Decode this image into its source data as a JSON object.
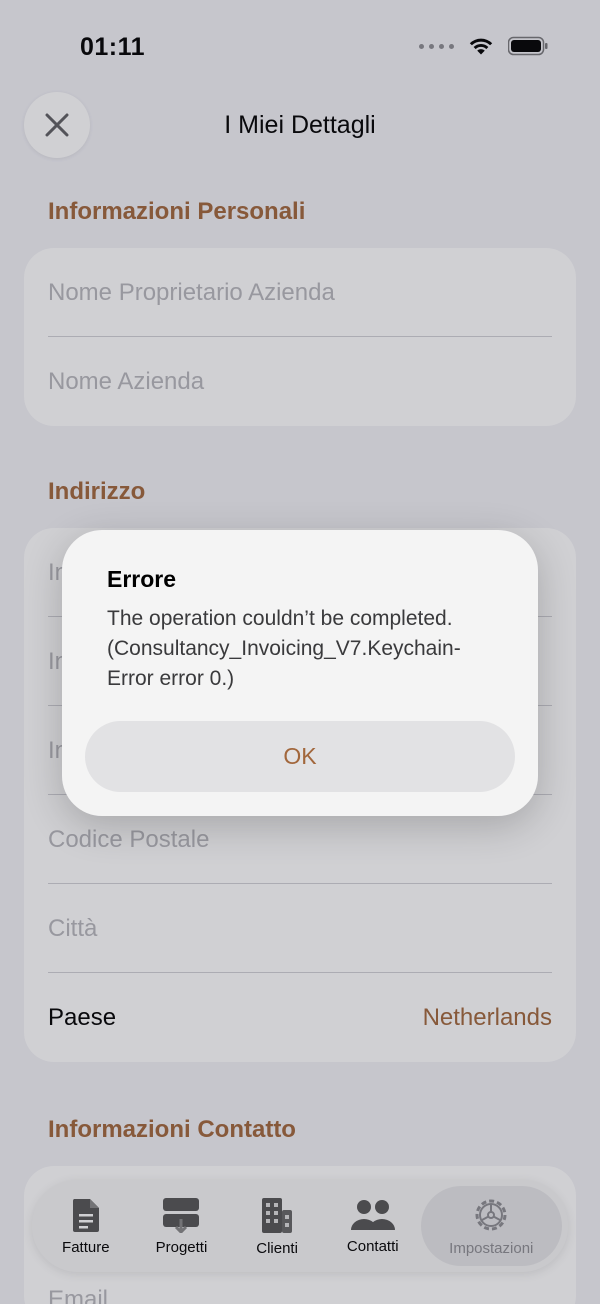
{
  "status_bar": {
    "time": "01:11"
  },
  "nav": {
    "title": "I Miei Dettagli",
    "close_icon": "close-icon"
  },
  "sections": {
    "personal": {
      "header": "Informazioni Personali",
      "fields": [
        {
          "placeholder": "Nome Proprietario Azienda"
        },
        {
          "placeholder": "Nome Azienda"
        }
      ]
    },
    "address": {
      "header": "Indirizzo",
      "fields": [
        {
          "placeholder": "In"
        },
        {
          "placeholder": "In"
        },
        {
          "placeholder": "In"
        },
        {
          "placeholder": "Codice Postale"
        },
        {
          "placeholder": "Città"
        }
      ],
      "country_label": "Paese",
      "country_value": "Netherlands"
    },
    "contact": {
      "header": "Informazioni Contatto",
      "email_placeholder": "Email"
    }
  },
  "tabs": [
    {
      "label": "Fatture",
      "icon": "document-icon"
    },
    {
      "label": "Progetti",
      "icon": "projects-icon"
    },
    {
      "label": "Clienti",
      "icon": "building-icon"
    },
    {
      "label": "Contatti",
      "icon": "people-icon"
    },
    {
      "label": "Impostazioni",
      "icon": "gear-icon",
      "active": true
    }
  ],
  "alert": {
    "title": "Errore",
    "message": "The operation couldn’t be completed. (Consultancy_Invoicing_V7.Keychain-Error error 0.)",
    "ok_label": "OK"
  },
  "colors": {
    "accent": "#a2673c",
    "background": "#f2f2f7",
    "card": "#ffffff"
  }
}
